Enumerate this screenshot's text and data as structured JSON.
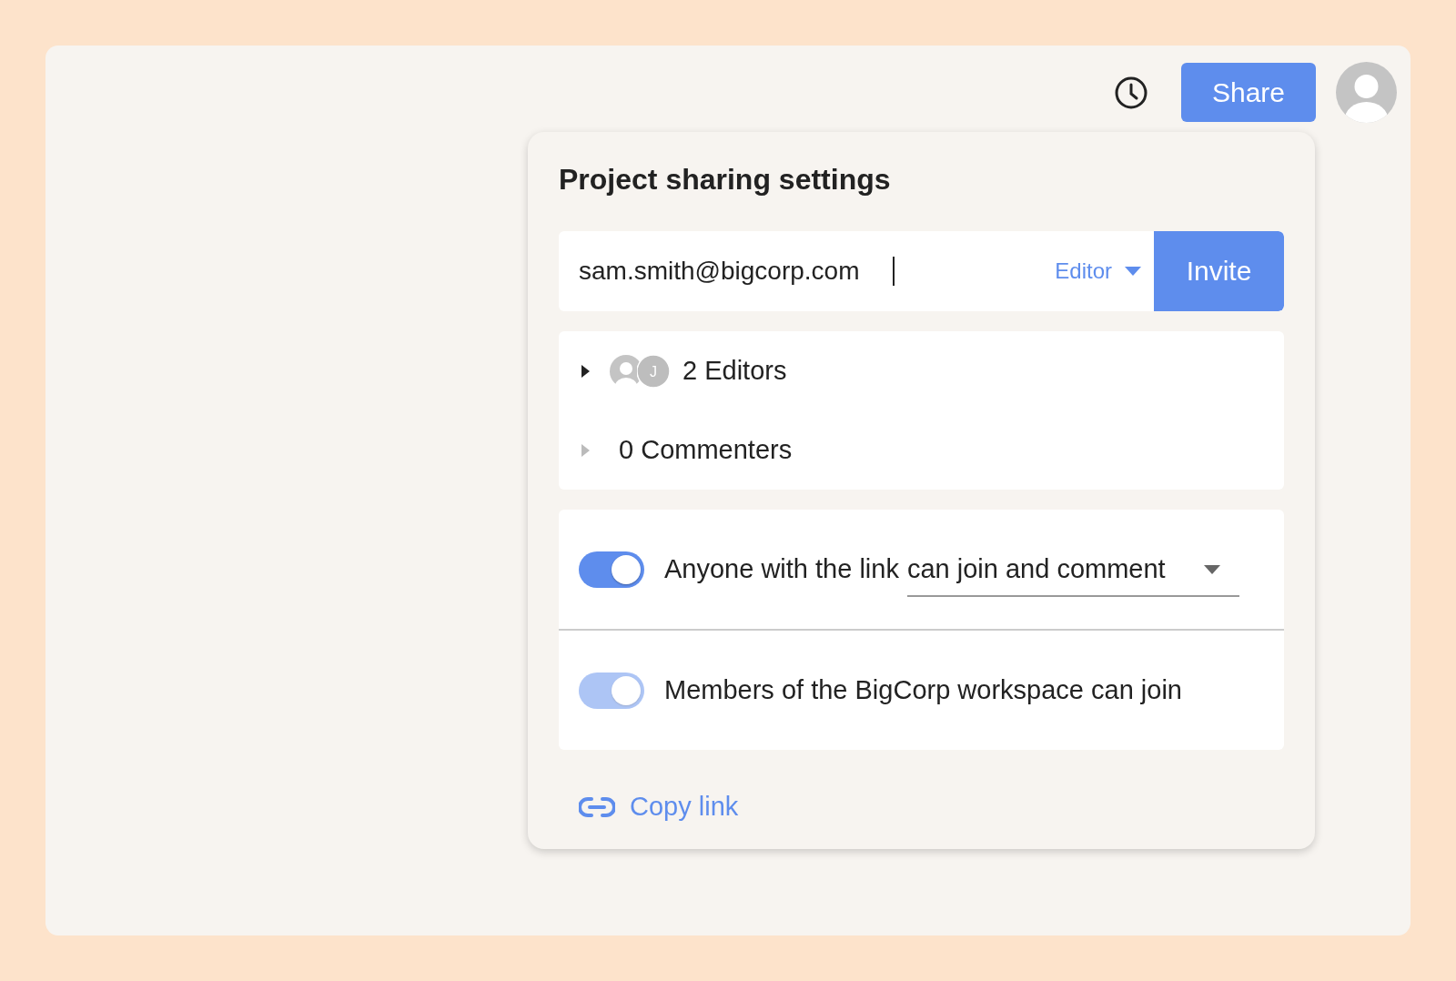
{
  "toolbar": {
    "share_button": "Share"
  },
  "dialog": {
    "title": "Project sharing settings",
    "invite": {
      "value": "sam.smith@bigcorp.com",
      "role": "Editor",
      "button": "Invite"
    },
    "groups": [
      {
        "label": "2 Editors",
        "expanded": false,
        "disabled": false,
        "avatars": [
          {
            "kind": "silhouette"
          },
          {
            "kind": "initial",
            "initial": "J"
          }
        ]
      },
      {
        "label": "0 Commenters",
        "expanded": false,
        "disabled": true
      }
    ],
    "link_settings": [
      {
        "label": "Anyone with the link",
        "on": true,
        "disabled": false,
        "dropdown": "can join and comment"
      },
      {
        "label": "Members of the BigCorp workspace can join",
        "on": true,
        "disabled": true
      }
    ],
    "copy_link": "Copy link"
  }
}
